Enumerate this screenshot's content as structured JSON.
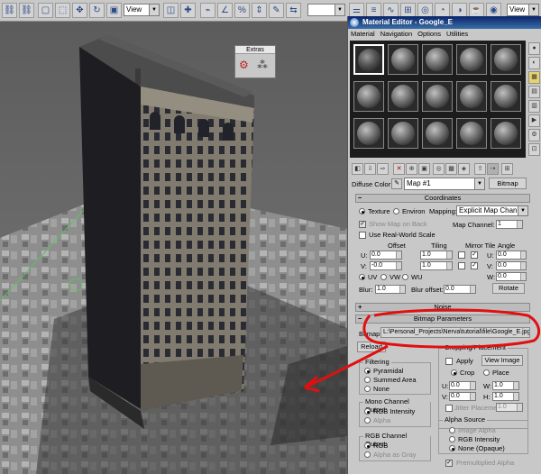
{
  "toolbar": {
    "view_dropdown": "View",
    "view_dropdown_right": "View"
  },
  "extras_floater": {
    "title": "Extras"
  },
  "material_editor": {
    "title": "Material Editor - Google_E",
    "menu": [
      "Material",
      "Navigation",
      "Options",
      "Utilities"
    ],
    "diffuse_label": "Diffuse Color:",
    "map_name": "Map #1",
    "map_type_button": "Bitmap",
    "coordinates": {
      "header": "Coordinates",
      "texture_label": "Texture",
      "environ_label": "Environ",
      "mapping_label": "Mapping:",
      "mapping_value": "Explicit Map Channel",
      "show_map_on_back": "Show Map on Back",
      "map_channel_label": "Map Channel:",
      "map_channel_value": "1",
      "use_real_world_scale": "Use Real-World Scale",
      "offset_label": "Offset",
      "tiling_label": "Tiling",
      "mirror_tile_label": "Mirror Tile",
      "angle_label": "Angle",
      "u_label": "U:",
      "v_label": "V:",
      "w_label": "W:",
      "u_offset": "0.0",
      "v_offset": "-0.0",
      "u_tiling": "1.0",
      "v_tiling": "1.0",
      "u_angle": "0.0",
      "v_angle": "0.0",
      "w_angle": "0.0",
      "uv_label": "UV",
      "vw_label": "VW",
      "wu_label": "WU",
      "blur_label": "Blur:",
      "blur_value": "1.0",
      "blur_offset_label": "Blur offset:",
      "blur_offset_value": "0.0",
      "rotate_button": "Rotate"
    },
    "noise": {
      "header": "Noise"
    },
    "bitmap_parameters": {
      "header": "Bitmap Parameters",
      "bitmap_label": "Bitmap:",
      "bitmap_path": "L:\\Personal_Projects\\Nerva\\tutorial\\file\\Google_E.jpg",
      "reload_button": "Reload",
      "cropping_title": "Cropping/Placement",
      "apply_label": "Apply",
      "view_image_button": "View Image",
      "crop_label": "Crop",
      "place_label": "Place",
      "u_label": "U:",
      "v_label": "V:",
      "w_label": "W:",
      "h_label": "H:",
      "crop_u": "0.0",
      "crop_v": "0.0",
      "crop_w": "1.0",
      "crop_h": "1.0",
      "jitter_label": "Jitter Placement:",
      "jitter_value": "1.0",
      "filtering_title": "Filtering",
      "pyramidal": "Pyramidal",
      "summed_area": "Summed Area",
      "none": "None",
      "mono_title": "Mono Channel Output:",
      "rgb_intensity": "RGB Intensity",
      "alpha": "Alpha",
      "rgb_channel_title": "RGB Channel Output:",
      "rgb": "RGB",
      "alpha_as_gray": "Alpha as Gray",
      "alpha_source_title": "Alpha Source",
      "image_alpha": "Image Alpha",
      "alpha_rgb_intensity": "RGB Intensity",
      "none_opaque": "None (Opaque)",
      "premultiplied_alpha": "Premultiplied Alpha"
    }
  },
  "colors": {
    "annotation_red": "#e01010",
    "title_bar": "#0a246a",
    "panel_bg": "#c8c8c8"
  }
}
